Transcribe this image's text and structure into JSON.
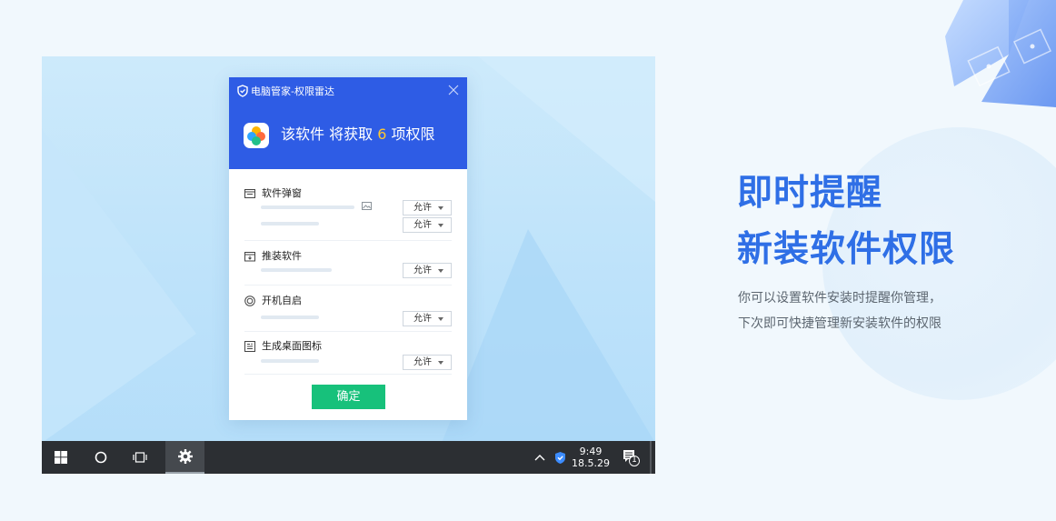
{
  "dialog": {
    "title": "电脑管家-权限雷达",
    "headline_prefix": "该软件 将获取",
    "permission_count": "6",
    "headline_suffix": "项权限",
    "sections": [
      {
        "label": "软件弹窗",
        "icon": "popup-window-icon",
        "options": [
          "允许",
          "允许"
        ]
      },
      {
        "label": "推装软件",
        "icon": "install-box-icon",
        "options": [
          "允许"
        ]
      },
      {
        "label": "开机自启",
        "icon": "power-icon",
        "options": [
          "允许"
        ]
      },
      {
        "label": "生成桌面图标",
        "icon": "desktop-shortcut-icon",
        "options": [
          "允许"
        ]
      }
    ],
    "confirm_label": "确定",
    "accent_color": "#2e5ce5",
    "confirm_color": "#17c17b",
    "count_color": "#ffc830"
  },
  "taskbar": {
    "time": "9:49",
    "date": "18.5.29",
    "notification_count": "1",
    "icons": [
      "windows-start-icon",
      "cortana-circle-icon",
      "task-view-icon",
      "settings-gear-icon",
      "tray-chevron-up-icon",
      "shield-tray-icon",
      "action-center-icon"
    ]
  },
  "promo": {
    "line1": "即时提醒",
    "line2": "新装软件权限",
    "desc_line1": "你可以设置软件安装时提醒你管理，",
    "desc_line2": "下次即可快捷管理新安装软件的权限",
    "headline_color": "#2f6fe6"
  }
}
